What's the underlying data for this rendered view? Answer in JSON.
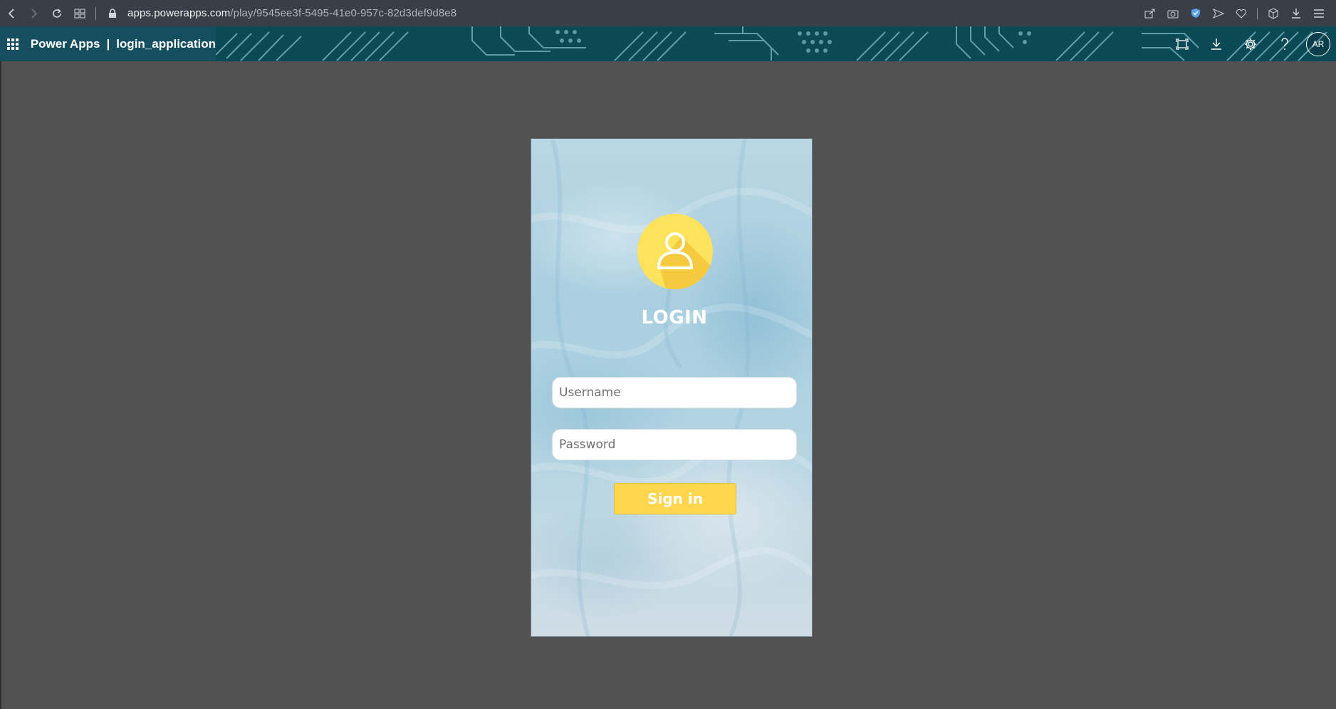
{
  "browser": {
    "url_host": "apps.powerapps.com",
    "url_path": "/play/9545ee3f-5495-41e0-957c-82d3def9d8e8",
    "icons": [
      "back-icon",
      "forward-icon",
      "reload-icon",
      "tabs-grid-icon",
      "lock-icon",
      "share-icon",
      "camera-icon",
      "shield-icon",
      "send-icon",
      "heart-icon",
      "cube-icon",
      "download-icon",
      "menu-lines-icon"
    ]
  },
  "header": {
    "brand": "Power Apps",
    "separator": "|",
    "app_name": "login_application",
    "avatar_initials": "AR",
    "background_color": "#0b4a59"
  },
  "login": {
    "title": "LOGIN",
    "username_placeholder": "Username",
    "password_placeholder": "Password",
    "signin_label": "Sign in",
    "accent_color": "#fdd64e"
  }
}
